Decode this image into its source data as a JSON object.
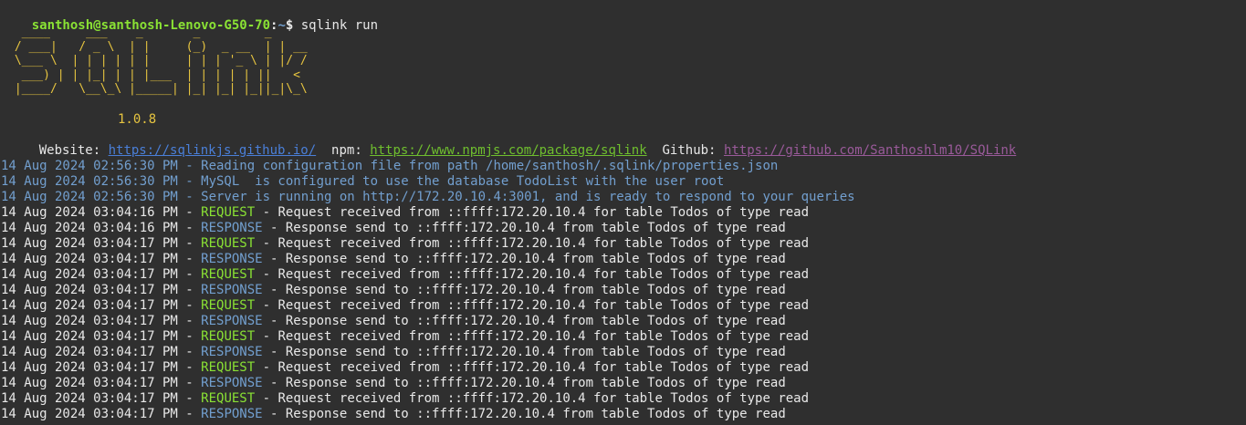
{
  "colors": {
    "background": "#2f2f2f",
    "text": "#e8e8e8",
    "prompt_user": "#8ae234",
    "prompt_path": "#729fcf",
    "banner": "#e6c440",
    "link_blue": "#4a7fd8",
    "link_green": "#6fbf2e",
    "link_purple": "#9a5a9a",
    "info_blue": "#729fcf",
    "request_green": "#8ae234",
    "response_blue": "#729fcf"
  },
  "prompt": {
    "user_host": "santhosh@santhosh-Lenovo-G50-70",
    "separator": ":",
    "path": "~",
    "symbol": "$",
    "command": " sqlink run"
  },
  "banner": {
    "ascii": "  ____     ___    _       _         _    \n / ___|   / _ \\  | |     (_)  _ __  | | __\n \\___ \\  | | | | | |     | | | '_ \\ | |/ /\n  ___) | | |_| | | |___  | | | | | ||   < \n |____/   \\__\\_\\ |_____| |_| |_| |_||_|\\_\\",
    "version": "1.0.8"
  },
  "links": {
    "website_label": "Website:",
    "website_url": "https://sqlinkjs.github.io/",
    "npm_label": "npm:",
    "npm_url": "https://www.npmjs.com/package/sqlink",
    "github_label": "Github:",
    "github_url": "https://github.com/Santhoshlm10/SQLink"
  },
  "info_logs": [
    "14 Aug 2024 02:56:30 PM - Reading configuration file from path /home/santhosh/.sqlink/properties.json",
    "14 Aug 2024 02:56:30 PM - MySQL  is configured to use the database TodoList with the user root",
    "14 Aug 2024 02:56:30 PM - Server is running on http://172.20.10.4:3001, and is ready to respond to your queries"
  ],
  "request_logs": [
    {
      "time": "14 Aug 2024 03:04:16 PM - ",
      "kind": "REQUEST",
      "message": " - Request received from ::ffff:172.20.10.4 for table Todos of type read"
    },
    {
      "time": "14 Aug 2024 03:04:16 PM - ",
      "kind": "RESPONSE",
      "message": " - Response send to ::ffff:172.20.10.4 from table Todos of type read"
    },
    {
      "time": "14 Aug 2024 03:04:17 PM - ",
      "kind": "REQUEST",
      "message": " - Request received from ::ffff:172.20.10.4 for table Todos of type read"
    },
    {
      "time": "14 Aug 2024 03:04:17 PM - ",
      "kind": "RESPONSE",
      "message": " - Response send to ::ffff:172.20.10.4 from table Todos of type read"
    },
    {
      "time": "14 Aug 2024 03:04:17 PM - ",
      "kind": "REQUEST",
      "message": " - Request received from ::ffff:172.20.10.4 for table Todos of type read"
    },
    {
      "time": "14 Aug 2024 03:04:17 PM - ",
      "kind": "RESPONSE",
      "message": " - Response send to ::ffff:172.20.10.4 from table Todos of type read"
    },
    {
      "time": "14 Aug 2024 03:04:17 PM - ",
      "kind": "REQUEST",
      "message": " - Request received from ::ffff:172.20.10.4 for table Todos of type read"
    },
    {
      "time": "14 Aug 2024 03:04:17 PM - ",
      "kind": "RESPONSE",
      "message": " - Response send to ::ffff:172.20.10.4 from table Todos of type read"
    },
    {
      "time": "14 Aug 2024 03:04:17 PM - ",
      "kind": "REQUEST",
      "message": " - Request received from ::ffff:172.20.10.4 for table Todos of type read"
    },
    {
      "time": "14 Aug 2024 03:04:17 PM - ",
      "kind": "RESPONSE",
      "message": " - Response send to ::ffff:172.20.10.4 from table Todos of type read"
    },
    {
      "time": "14 Aug 2024 03:04:17 PM - ",
      "kind": "REQUEST",
      "message": " - Request received from ::ffff:172.20.10.4 for table Todos of type read"
    },
    {
      "time": "14 Aug 2024 03:04:17 PM - ",
      "kind": "RESPONSE",
      "message": " - Response send to ::ffff:172.20.10.4 from table Todos of type read"
    },
    {
      "time": "14 Aug 2024 03:04:17 PM - ",
      "kind": "REQUEST",
      "message": " - Request received from ::ffff:172.20.10.4 for table Todos of type read"
    },
    {
      "time": "14 Aug 2024 03:04:17 PM - ",
      "kind": "RESPONSE",
      "message": " - Response send to ::ffff:172.20.10.4 from table Todos of type read"
    }
  ]
}
